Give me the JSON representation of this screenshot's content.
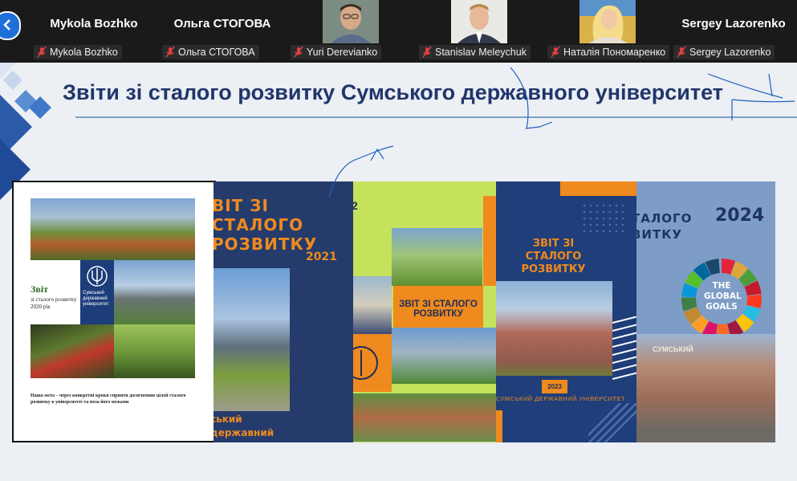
{
  "participants": [
    {
      "display": "Mykola Bozhko",
      "caption": "Mykola Bozhko",
      "video": false
    },
    {
      "display": "Ольга СТОГОВА",
      "caption": "Ольга СТОГОВА",
      "video": false
    },
    {
      "display": "",
      "caption": "Yuri Derevianko",
      "video": true
    },
    {
      "display": "",
      "caption": "Stanislav Meleychuk",
      "video": true
    },
    {
      "display": "",
      "caption": "Наталія Пономаренко",
      "video": true
    },
    {
      "display": "Sergey Lazorenko",
      "caption": "Sergey Lazorenko",
      "video": false
    }
  ],
  "slide": {
    "title": "Звіти зі сталого розвитку Сумського державного університет",
    "covers": {
      "c1": {
        "title": "Звіт",
        "subtitle": "зі сталого розвитку 2020 рік",
        "logo": "Сумський державний університет",
        "goal": "Наша мета – через конкретні кроки сприяти досягненню цілей сталого розвитку в університеті та поза його межами"
      },
      "c2": {
        "title": "ВІТ ЗІ СТАЛОГО РОЗВИТКУ",
        "year": "2021",
        "bottom": "ський державний ерситет"
      },
      "c3": {
        "fragment": "2",
        "label": "ЗВІТ ЗІ СТАЛОГО РОЗВИТКУ"
      },
      "c4": {
        "title": "ЗВІТ ЗІ СТАЛОГО РОЗВИТКУ",
        "year": "2023",
        "uni": "СУМСЬКИЙ ДЕРЖАВНИЙ УНІВЕРСИТЕТ"
      },
      "c5": {
        "title": "ТАЛОГО ВИТКУ",
        "year": "2024",
        "goals": "THE GLOBAL GOALS",
        "sign": "СУМСЬКИЙ"
      }
    }
  },
  "colors": {
    "accent_orange": "#ef8a1e",
    "navy": "#20366b"
  }
}
